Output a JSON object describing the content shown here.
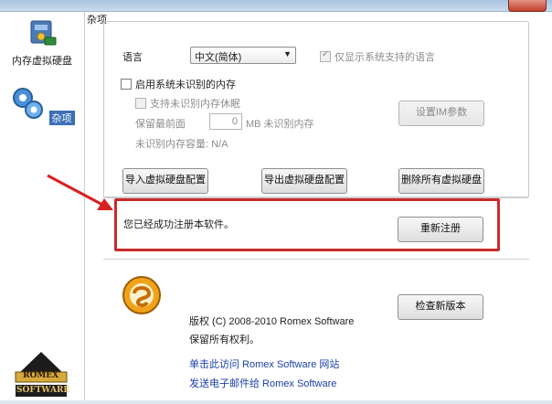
{
  "sidebar": {
    "items": [
      {
        "label": "内存虚拟硬盘",
        "icon": "ram-disk-icon"
      },
      {
        "label": "杂项",
        "icon": "gears-icon",
        "selected": true
      }
    ],
    "logo_line1": "ROMEX",
    "logo_line2": "SOFTWARE"
  },
  "main": {
    "section_title": "杂项",
    "language_label": "语言",
    "language_value": "中文(简体)",
    "show_supported_label": "仅显示系统支持的语言",
    "enable_unrecognized_label": "启用系统未识别的内存",
    "support_hibernate_label": "支持未识别内存休眠",
    "reserve_label": "保留最前面",
    "reserve_value": "0",
    "reserve_unit": "MB 未识别内存",
    "capacity_label": "未识别内存容量: N/A",
    "set_im_button": "设置IM参数",
    "import_button": "导入虚拟硬盘配置",
    "export_button": "导出虚拟硬盘配置",
    "delete_all_button": "删除所有虚拟硬盘",
    "registered_text": "您已经成功注册本软件。",
    "reregister_button": "重新注册",
    "check_version_button": "检查新版本",
    "copyright": "版权 (C) 2008-2010 Romex Software",
    "rights": "保留所有权利。",
    "visit_link": "单击此访问 Romex Software 网站",
    "email_link": "发送电子邮件给 Romex Software"
  },
  "colors": {
    "highlight_box": "#cc2a2a",
    "arrow": "#d92020",
    "link": "#1a3fa8",
    "selection": "#3b6fb7"
  }
}
